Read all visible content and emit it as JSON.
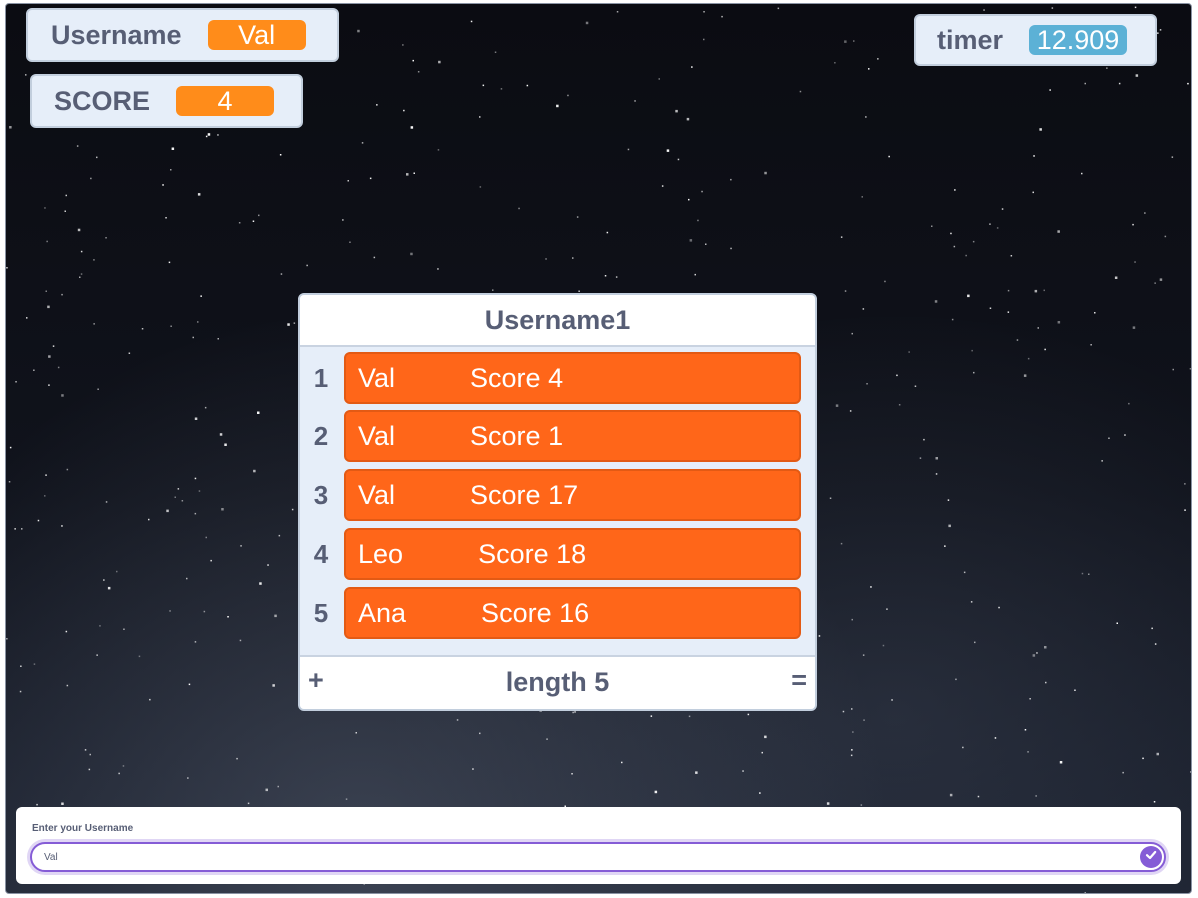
{
  "monitors": {
    "username": {
      "label": "Username",
      "value": "Val"
    },
    "score": {
      "label": "SCORE",
      "value": "4"
    },
    "timer": {
      "label": "timer",
      "value": "12.909"
    }
  },
  "list": {
    "title": "Username1",
    "items": [
      {
        "index": "1",
        "text": "Val          Score 4"
      },
      {
        "index": "2",
        "text": "Val          Score 1"
      },
      {
        "index": "3",
        "text": "Val          Score 17"
      },
      {
        "index": "4",
        "text": "Leo          Score 18"
      },
      {
        "index": "5",
        "text": "Ana          Score 16"
      }
    ],
    "add_symbol": "+",
    "length_label": "length 5",
    "resize_symbol": "="
  },
  "ask": {
    "prompt": "Enter your Username",
    "value": "Val"
  },
  "icons": {
    "submit": "check-circle-icon"
  },
  "colors": {
    "variable_orange": "#ff8c1a",
    "sensing_blue": "#5cb1d6",
    "list_orange": "#ff6619",
    "input_purple": "#855cd6"
  }
}
